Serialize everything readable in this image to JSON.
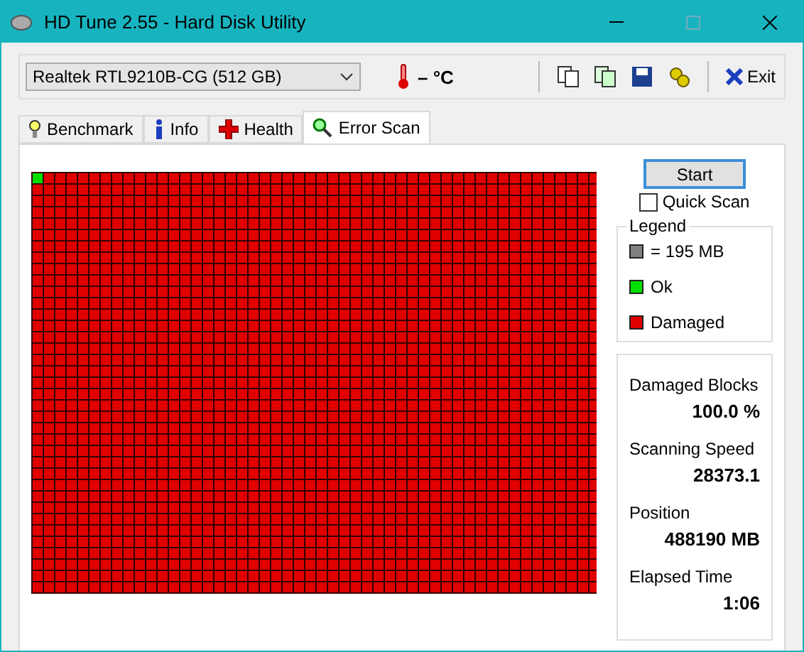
{
  "window": {
    "title": "HD Tune 2.55 - Hard Disk Utility"
  },
  "toolbar": {
    "drive": "Realtek RTL9210B-CG (512 GB)",
    "temperature": "– °C",
    "exit_label": "Exit"
  },
  "tabs": [
    {
      "label": "Benchmark",
      "selected": false
    },
    {
      "label": "Info",
      "selected": false
    },
    {
      "label": "Health",
      "selected": false
    },
    {
      "label": "Error Scan",
      "selected": true
    }
  ],
  "scan": {
    "start_label": "Start",
    "quick_scan": {
      "label": "Quick Scan",
      "checked": false
    }
  },
  "legend": {
    "title": "Legend",
    "items": [
      {
        "label": "= 195 MB",
        "color": "#808080"
      },
      {
        "label": "Ok",
        "color": "#00e000"
      },
      {
        "label": "Damaged",
        "color": "#e00000"
      }
    ]
  },
  "stats": [
    {
      "label": "Damaged Blocks",
      "value": "100.0 %"
    },
    {
      "label": "Scanning Speed",
      "value": "28373.1"
    },
    {
      "label": "Position",
      "value": "488190 MB"
    },
    {
      "label": "Elapsed Time",
      "value": "1:06"
    }
  ]
}
